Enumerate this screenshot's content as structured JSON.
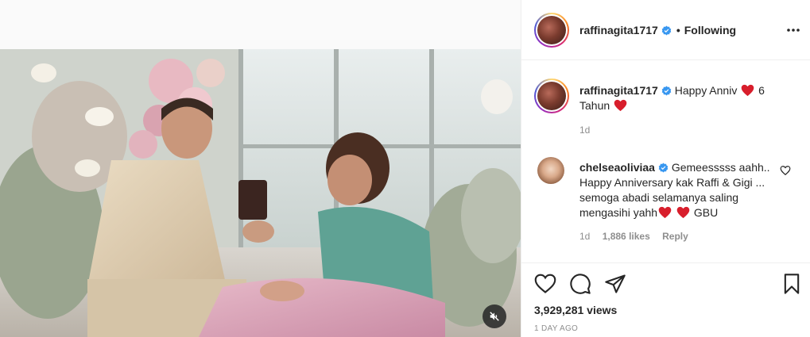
{
  "media": {
    "mute_icon": "speaker-muted-icon"
  },
  "header": {
    "username": "raffinagita1717",
    "verified_icon": "verified-badge-icon",
    "separator": "•",
    "follow_status": "Following",
    "more_icon": "more-options-icon"
  },
  "caption": {
    "username": "raffinagita1717",
    "text_part1": "Happy Anniv",
    "text_part2": "6",
    "text_part3": "Tahun",
    "time": "1d"
  },
  "comment": {
    "username": "chelseaoliviaa",
    "text_part1": "Gemeesssss aahh.. Happy Anniversary kak Raffi & Gigi ... semoga abadi selamanya saling mengasihi yahh",
    "text_part2": "GBU",
    "time": "1d",
    "likes": "1,886 likes",
    "reply": "Reply"
  },
  "actions": {
    "like_icon": "heart-icon",
    "comment_icon": "comment-icon",
    "share_icon": "paper-plane-icon",
    "save_icon": "bookmark-icon",
    "views": "3,929,281 views",
    "posted": "1 DAY AGO"
  },
  "colors": {
    "verified": "#3897f0",
    "heart": "#ed4956",
    "secondary_text": "#8e8e8e"
  }
}
